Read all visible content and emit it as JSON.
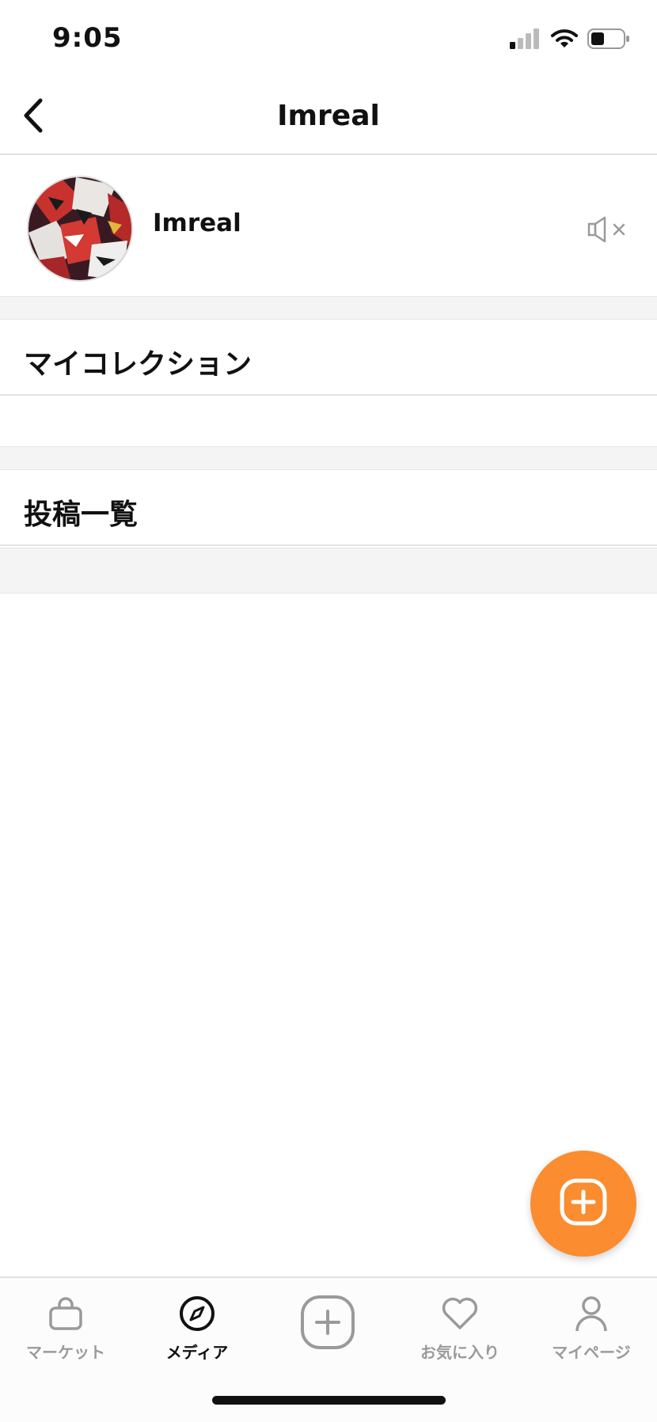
{
  "status_bar": {
    "time": "9:05",
    "signal_icon": "cellular-signal-icon",
    "wifi_icon": "wifi-icon",
    "battery_icon": "battery-icon"
  },
  "nav": {
    "title": "Imreal",
    "back_icon": "chevron-left-icon"
  },
  "profile": {
    "name": "Imreal",
    "avatar": "avatar-image",
    "mute_icon": "speaker-muted-icon"
  },
  "sections": {
    "collection_title": "マイコレクション",
    "posts_title": "投稿一覧"
  },
  "fab": {
    "icon": "plus-square-icon",
    "color": "#fb8c2f"
  },
  "tabs": [
    {
      "label": "マーケット",
      "icon": "shopping-bag-icon",
      "active": false
    },
    {
      "label": "メディア",
      "icon": "compass-icon",
      "active": true
    },
    {
      "label": "",
      "icon": "plus-square-icon",
      "active": false
    },
    {
      "label": "お気に入り",
      "icon": "heart-icon",
      "active": false
    },
    {
      "label": "マイページ",
      "icon": "user-icon",
      "active": false
    }
  ],
  "colors": {
    "accent": "#fb8c2f",
    "inactive": "#9a9a9a",
    "active": "#111111"
  }
}
